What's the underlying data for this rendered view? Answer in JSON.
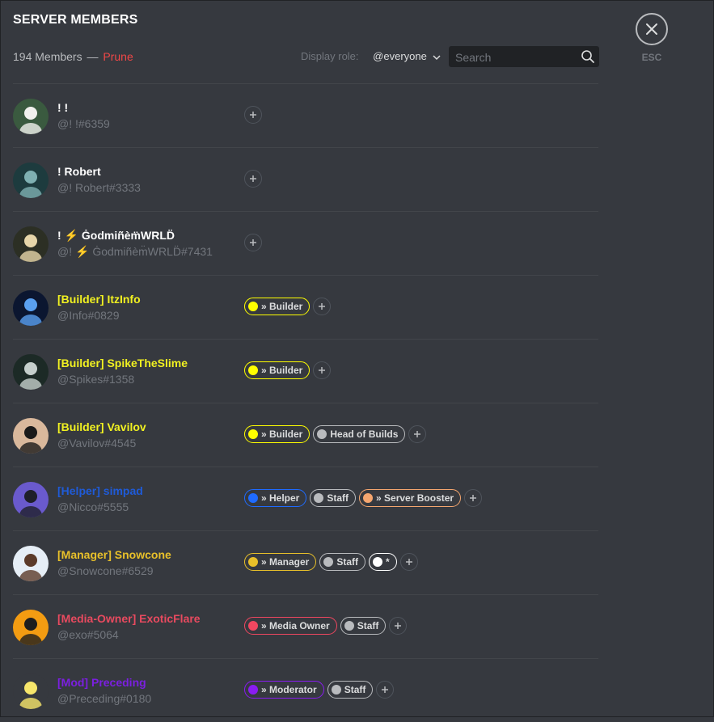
{
  "header": {
    "title": "SERVER MEMBERS",
    "member_count": "194 Members",
    "separator": "—",
    "prune_label": "Prune",
    "display_role_label": "Display role:",
    "display_role_value": "@everyone",
    "search_placeholder": "Search",
    "close_label": "ESC"
  },
  "icons": {
    "close": "close-icon",
    "search": "search-icon",
    "dropdown": "chevron-down-icon",
    "add_role": "plus-icon"
  },
  "colors": {
    "background": "#36393f",
    "prune": "#f04747",
    "divider": "#42454a"
  },
  "members": [
    {
      "name": "! !",
      "tag": "@! !#6359",
      "name_color": "#ffffff",
      "avatar_color": "#3a5a3f",
      "avatar_accent": "#f1f1ee",
      "roles": []
    },
    {
      "name": "! Robert",
      "tag": "@! Robert#3333",
      "name_color": "#ffffff",
      "avatar_color": "#1d3b3e",
      "avatar_accent": "#7fb0b2",
      "roles": []
    },
    {
      "name": "! ⚡ Ġodmiñèm̈WRLD̈",
      "tag": "@! ⚡ Ġodmiñèm̈WRLD̈#7431",
      "name_color": "#ffffff",
      "avatar_color": "#2c2f24",
      "avatar_accent": "#e7d6a9",
      "roles": []
    },
    {
      "name": "[Builder] ItzInfo",
      "tag": "@Info#0829",
      "name_color": "#f1f121",
      "avatar_color": "#0b1630",
      "avatar_accent": "#5aa0f0",
      "roles": [
        {
          "label": "» Builder",
          "color": "#ffff00"
        }
      ]
    },
    {
      "name": "[Builder] SpikeTheSlime",
      "tag": "@Spikes#1358",
      "name_color": "#f1f121",
      "avatar_color": "#1c2a26",
      "avatar_accent": "#c5cfcc",
      "roles": [
        {
          "label": "» Builder",
          "color": "#ffff00"
        }
      ]
    },
    {
      "name": "[Builder] Vavilov",
      "tag": "@Vavilov#4545",
      "name_color": "#f1f121",
      "avatar_color": "#d9b89c",
      "avatar_accent": "#1a1a1a",
      "roles": [
        {
          "label": "» Builder",
          "color": "#ffff00"
        },
        {
          "label": "Head of Builds",
          "color": "#b9bbbe"
        }
      ]
    },
    {
      "name": "[Helper] simpad",
      "tag": "@Nicco#5555",
      "name_color": "#1f5bd8",
      "avatar_color": "#6a5acd",
      "avatar_accent": "#1f1f2a",
      "roles": [
        {
          "label": "» Helper",
          "color": "#1f6bff"
        },
        {
          "label": "Staff",
          "color": "#b9bbbe"
        },
        {
          "label": "» Server Booster",
          "color": "#f5a66f"
        }
      ]
    },
    {
      "name": "[Manager] Snowcone",
      "tag": "@Snowcone#6529",
      "name_color": "#e8c02a",
      "avatar_color": "#e6eef6",
      "avatar_accent": "#5b3a29",
      "roles": [
        {
          "label": "» Manager",
          "color": "#e8c02a"
        },
        {
          "label": "Staff",
          "color": "#b9bbbe"
        },
        {
          "label": "*",
          "color": "#ffffff"
        }
      ]
    },
    {
      "name": "[Media-Owner] ExoticFlare",
      "tag": "@exo#5064",
      "name_color": "#e84a5f",
      "avatar_color": "#f39c12",
      "avatar_accent": "#1e1e1e",
      "roles": [
        {
          "label": "» Media Owner",
          "color": "#f04760"
        },
        {
          "label": "Staff",
          "color": "#b9bbbe"
        }
      ]
    },
    {
      "name": "[Mod] Preceding",
      "tag": "@Preceding#0180",
      "name_color": "#7b1fe0",
      "avatar_color": "#36393f",
      "avatar_accent": "#f7e66b",
      "roles": [
        {
          "label": "» Moderator",
          "color": "#8a1cf2"
        },
        {
          "label": "Staff",
          "color": "#b9bbbe"
        }
      ]
    }
  ]
}
